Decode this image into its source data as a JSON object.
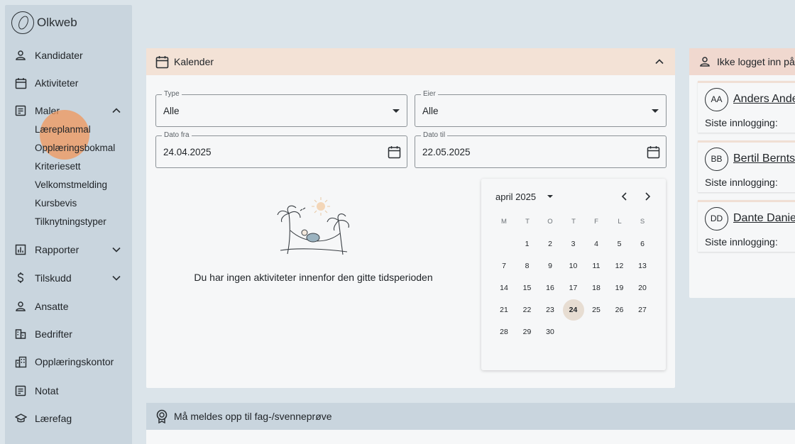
{
  "app": {
    "logo_text": "Olkweb"
  },
  "sidebar": {
    "items": [
      {
        "label": "Kandidater",
        "icon": "person-icon"
      },
      {
        "label": "Aktiviteter",
        "icon": "calendar-icon"
      },
      {
        "label": "Maler",
        "icon": "template-icon",
        "expanded": true
      },
      {
        "label": "Rapporter",
        "icon": "bar-chart-icon",
        "expanded": false
      },
      {
        "label": "Tilskudd",
        "icon": "dollar-icon",
        "expanded": false
      },
      {
        "label": "Ansatte",
        "icon": "person-icon"
      },
      {
        "label": "Bedrifter",
        "icon": "company-icon"
      },
      {
        "label": "Opplæringskontor",
        "icon": "building-icon"
      },
      {
        "label": "Notat",
        "icon": "note-icon"
      },
      {
        "label": "Lærefag",
        "icon": "school-icon"
      }
    ],
    "maler_subitems": [
      "Læreplanmal",
      "Opplæringsbokmal",
      "Kriteriesett",
      "Velkomstmelding",
      "Kursbevis",
      "Tilknytningstyper"
    ]
  },
  "calendar_panel": {
    "title": "Kalender",
    "type_field": {
      "label": "Type",
      "value": "Alle"
    },
    "owner_field": {
      "label": "Eier",
      "value": "Alle"
    },
    "from_field": {
      "label": "Dato fra",
      "value": "24.04.2025"
    },
    "to_field": {
      "label": "Dato til",
      "value": "22.05.2025"
    },
    "empty_message": "Du har ingen aktiviteter innenfor den gitte tidsperioden"
  },
  "datepicker": {
    "month_label": "april 2025",
    "weekdays": [
      "M",
      "T",
      "O",
      "T",
      "F",
      "L",
      "S"
    ],
    "first_weekday_index": 1,
    "days_in_month": 30,
    "selected_day": 24
  },
  "inactive_panel": {
    "title": "Ikke logget inn på",
    "users": [
      {
        "initials": "AA",
        "name": "Anders Ande",
        "last_login_label": "Siste innlogging:"
      },
      {
        "initials": "BB",
        "name": "Bertil Bernts",
        "last_login_label": "Siste innlogging:"
      },
      {
        "initials": "DD",
        "name": "Dante Daniel",
        "last_login_label": "Siste innlogging:"
      }
    ]
  },
  "exam_panel": {
    "title": "Må meldes opp til fag-/svenneprøve"
  },
  "colors": {
    "background": "#dbe4ea",
    "sidebar": "#c9d5de",
    "calendar_header": "#f3e2d6",
    "inactive_header": "#f0d8cf",
    "today_highlight": "#e7ddd2",
    "click_ripple": "#f0965a"
  }
}
